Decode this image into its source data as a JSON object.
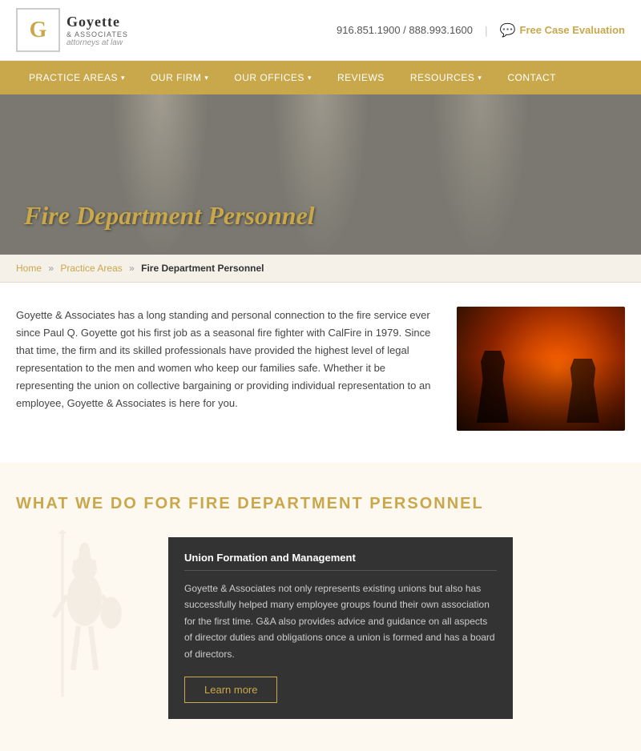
{
  "header": {
    "logo_letter": "G",
    "logo_name": "Goyette",
    "logo_associates": "& ASSOCIATES",
    "logo_tagline": "attorneys at law",
    "phone": "916.851.1900 / 888.993.1600",
    "free_case_label": "Free Case Evaluation"
  },
  "nav": {
    "items": [
      {
        "label": "PRACTICE AREAS",
        "has_dropdown": true
      },
      {
        "label": "OUR FIRM",
        "has_dropdown": true
      },
      {
        "label": "OUR OFFICES",
        "has_dropdown": true
      },
      {
        "label": "REVIEWS",
        "has_dropdown": false
      },
      {
        "label": "RESOURCES",
        "has_dropdown": true
      },
      {
        "label": "CONTACT",
        "has_dropdown": false
      }
    ]
  },
  "hero": {
    "title": "Fire Department Personnel"
  },
  "breadcrumb": {
    "home": "Home",
    "practice_areas": "Practice Areas",
    "current": "Fire Department Personnel"
  },
  "content": {
    "body_text": "Goyette & Associates has a long standing and personal connection to the fire service ever since Paul Q. Goyette got his first job as a seasonal fire fighter with CalFire in 1979. Since that time, the firm and its skilled professionals have provided the highest level of legal representation to the men and women who keep our families safe. Whether it be representing the union on collective bargaining or providing individual representation to an employee, Goyette & Associates is here for you."
  },
  "what_we_do": {
    "section_title": "WHAT WE DO FOR FIRE DEPARTMENT PERSONNEL",
    "union_card": {
      "title": "Union Formation and Management",
      "body": "Goyette & Associates not only represents existing unions but also has successfully helped many employee groups found their own association for the first time. G&A also provides advice and guidance on all aspects of director duties and obligations once a union is formed and has a board of directors.",
      "learn_more": "Learn more"
    }
  }
}
